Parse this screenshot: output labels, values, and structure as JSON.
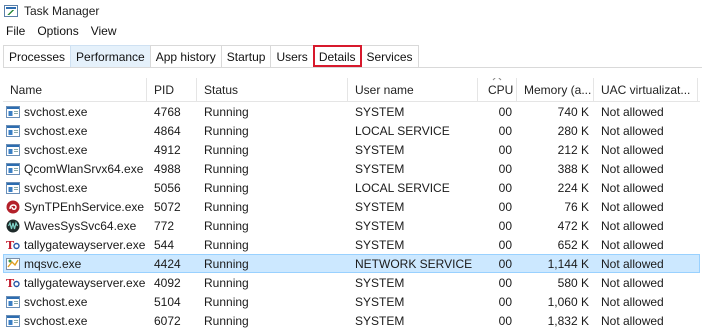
{
  "window": {
    "title": "Task Manager"
  },
  "menu": {
    "items": [
      "File",
      "Options",
      "View"
    ]
  },
  "tabs": [
    {
      "label": "Processes"
    },
    {
      "label": "Performance"
    },
    {
      "label": "App history"
    },
    {
      "label": "Startup"
    },
    {
      "label": "Users"
    },
    {
      "label": "Details"
    },
    {
      "label": "Services"
    }
  ],
  "table": {
    "columns": [
      "Name",
      "PID",
      "Status",
      "User name",
      "CPU",
      "Memory (a...",
      "UAC virtualizat..."
    ],
    "rows": [
      {
        "icon": "service-host-icon",
        "name": "svchost.exe",
        "pid": "4768",
        "status": "Running",
        "user": "SYSTEM",
        "cpu": "00",
        "memory": "740 K",
        "uac": "Not allowed"
      },
      {
        "icon": "service-host-icon",
        "name": "svchost.exe",
        "pid": "4864",
        "status": "Running",
        "user": "LOCAL SERVICE",
        "cpu": "00",
        "memory": "280 K",
        "uac": "Not allowed"
      },
      {
        "icon": "service-host-icon",
        "name": "svchost.exe",
        "pid": "4912",
        "status": "Running",
        "user": "SYSTEM",
        "cpu": "00",
        "memory": "212 K",
        "uac": "Not allowed"
      },
      {
        "icon": "service-host-icon",
        "name": "QcomWlanSrvx64.exe",
        "pid": "4988",
        "status": "Running",
        "user": "SYSTEM",
        "cpu": "00",
        "memory": "388 K",
        "uac": "Not allowed"
      },
      {
        "icon": "service-host-icon",
        "name": "svchost.exe",
        "pid": "5056",
        "status": "Running",
        "user": "LOCAL SERVICE",
        "cpu": "00",
        "memory": "224 K",
        "uac": "Not allowed"
      },
      {
        "icon": "synaptics-icon",
        "name": "SynTPEnhService.exe",
        "pid": "5072",
        "status": "Running",
        "user": "SYSTEM",
        "cpu": "00",
        "memory": "76 K",
        "uac": "Not allowed"
      },
      {
        "icon": "waves-icon",
        "name": "WavesSysSvc64.exe",
        "pid": "772",
        "status": "Running",
        "user": "SYSTEM",
        "cpu": "00",
        "memory": "472 K",
        "uac": "Not allowed"
      },
      {
        "icon": "tally-icon",
        "name": "tallygatewayserver.exe",
        "pid": "544",
        "status": "Running",
        "user": "SYSTEM",
        "cpu": "00",
        "memory": "652 K",
        "uac": "Not allowed"
      },
      {
        "icon": "mq-service-icon",
        "name": "mqsvc.exe",
        "pid": "4424",
        "status": "Running",
        "user": "NETWORK SERVICE",
        "cpu": "00",
        "memory": "1,144 K",
        "uac": "Not allowed",
        "selected": true
      },
      {
        "icon": "tally-icon",
        "name": "tallygatewayserver.exe",
        "pid": "4092",
        "status": "Running",
        "user": "SYSTEM",
        "cpu": "00",
        "memory": "580 K",
        "uac": "Not allowed"
      },
      {
        "icon": "service-host-icon",
        "name": "svchost.exe",
        "pid": "5104",
        "status": "Running",
        "user": "SYSTEM",
        "cpu": "00",
        "memory": "1,060 K",
        "uac": "Not allowed"
      },
      {
        "icon": "service-host-icon",
        "name": "svchost.exe",
        "pid": "6072",
        "status": "Running",
        "user": "SYSTEM",
        "cpu": "00",
        "memory": "1,832 K",
        "uac": "Not allowed"
      }
    ]
  },
  "colors": {
    "selection_bg": "#cce8ff",
    "selection_border": "#99d1ff",
    "highlight_outline": "#d7192c"
  }
}
